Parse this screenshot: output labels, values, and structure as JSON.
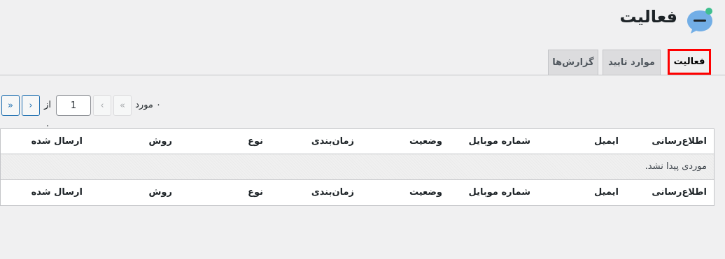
{
  "header": {
    "title": "فعالیت",
    "logo_icon": "chat-bubble-icon",
    "colors": {
      "logo_blue": "#72aee6",
      "logo_green": "#3fbf8f"
    }
  },
  "tabs": [
    {
      "label": "فعالیت",
      "active": true
    },
    {
      "label": "موارد تایید",
      "active": false
    },
    {
      "label": "گزارش‌ها",
      "active": false
    }
  ],
  "pagination": {
    "count_label": "۰ مورد",
    "first": "«",
    "prev": "‹",
    "current_page": "1",
    "of_label": "از ۰",
    "next": "›",
    "last": "»"
  },
  "table": {
    "columns": [
      "اطلاع‌رسانی",
      "ایمیل",
      "شماره موبایل",
      "وضعیت",
      "زمان‌بندی",
      "نوع",
      "روش",
      "ارسال شده"
    ],
    "empty_message": "موردی پیدا نشد."
  },
  "colors": {
    "accent": "#2271b1",
    "active_tab_border": "#ff0000"
  }
}
